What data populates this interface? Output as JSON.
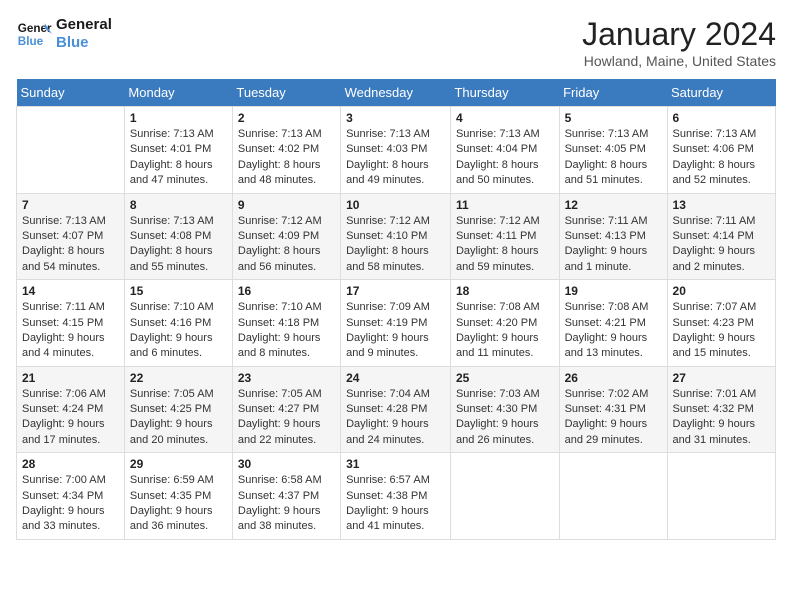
{
  "header": {
    "logo_line1": "General",
    "logo_line2": "Blue",
    "month_title": "January 2024",
    "location": "Howland, Maine, United States"
  },
  "days_of_week": [
    "Sunday",
    "Monday",
    "Tuesday",
    "Wednesday",
    "Thursday",
    "Friday",
    "Saturday"
  ],
  "weeks": [
    [
      {
        "num": "",
        "sunrise": "",
        "sunset": "",
        "daylight": ""
      },
      {
        "num": "1",
        "sunrise": "7:13 AM",
        "sunset": "4:01 PM",
        "daylight": "8 hours and 47 minutes."
      },
      {
        "num": "2",
        "sunrise": "7:13 AM",
        "sunset": "4:02 PM",
        "daylight": "8 hours and 48 minutes."
      },
      {
        "num": "3",
        "sunrise": "7:13 AM",
        "sunset": "4:03 PM",
        "daylight": "8 hours and 49 minutes."
      },
      {
        "num": "4",
        "sunrise": "7:13 AM",
        "sunset": "4:04 PM",
        "daylight": "8 hours and 50 minutes."
      },
      {
        "num": "5",
        "sunrise": "7:13 AM",
        "sunset": "4:05 PM",
        "daylight": "8 hours and 51 minutes."
      },
      {
        "num": "6",
        "sunrise": "7:13 AM",
        "sunset": "4:06 PM",
        "daylight": "8 hours and 52 minutes."
      }
    ],
    [
      {
        "num": "7",
        "sunrise": "7:13 AM",
        "sunset": "4:07 PM",
        "daylight": "8 hours and 54 minutes."
      },
      {
        "num": "8",
        "sunrise": "7:13 AM",
        "sunset": "4:08 PM",
        "daylight": "8 hours and 55 minutes."
      },
      {
        "num": "9",
        "sunrise": "7:12 AM",
        "sunset": "4:09 PM",
        "daylight": "8 hours and 56 minutes."
      },
      {
        "num": "10",
        "sunrise": "7:12 AM",
        "sunset": "4:10 PM",
        "daylight": "8 hours and 58 minutes."
      },
      {
        "num": "11",
        "sunrise": "7:12 AM",
        "sunset": "4:11 PM",
        "daylight": "8 hours and 59 minutes."
      },
      {
        "num": "12",
        "sunrise": "7:11 AM",
        "sunset": "4:13 PM",
        "daylight": "9 hours and 1 minute."
      },
      {
        "num": "13",
        "sunrise": "7:11 AM",
        "sunset": "4:14 PM",
        "daylight": "9 hours and 2 minutes."
      }
    ],
    [
      {
        "num": "14",
        "sunrise": "7:11 AM",
        "sunset": "4:15 PM",
        "daylight": "9 hours and 4 minutes."
      },
      {
        "num": "15",
        "sunrise": "7:10 AM",
        "sunset": "4:16 PM",
        "daylight": "9 hours and 6 minutes."
      },
      {
        "num": "16",
        "sunrise": "7:10 AM",
        "sunset": "4:18 PM",
        "daylight": "9 hours and 8 minutes."
      },
      {
        "num": "17",
        "sunrise": "7:09 AM",
        "sunset": "4:19 PM",
        "daylight": "9 hours and 9 minutes."
      },
      {
        "num": "18",
        "sunrise": "7:08 AM",
        "sunset": "4:20 PM",
        "daylight": "9 hours and 11 minutes."
      },
      {
        "num": "19",
        "sunrise": "7:08 AM",
        "sunset": "4:21 PM",
        "daylight": "9 hours and 13 minutes."
      },
      {
        "num": "20",
        "sunrise": "7:07 AM",
        "sunset": "4:23 PM",
        "daylight": "9 hours and 15 minutes."
      }
    ],
    [
      {
        "num": "21",
        "sunrise": "7:06 AM",
        "sunset": "4:24 PM",
        "daylight": "9 hours and 17 minutes."
      },
      {
        "num": "22",
        "sunrise": "7:05 AM",
        "sunset": "4:25 PM",
        "daylight": "9 hours and 20 minutes."
      },
      {
        "num": "23",
        "sunrise": "7:05 AM",
        "sunset": "4:27 PM",
        "daylight": "9 hours and 22 minutes."
      },
      {
        "num": "24",
        "sunrise": "7:04 AM",
        "sunset": "4:28 PM",
        "daylight": "9 hours and 24 minutes."
      },
      {
        "num": "25",
        "sunrise": "7:03 AM",
        "sunset": "4:30 PM",
        "daylight": "9 hours and 26 minutes."
      },
      {
        "num": "26",
        "sunrise": "7:02 AM",
        "sunset": "4:31 PM",
        "daylight": "9 hours and 29 minutes."
      },
      {
        "num": "27",
        "sunrise": "7:01 AM",
        "sunset": "4:32 PM",
        "daylight": "9 hours and 31 minutes."
      }
    ],
    [
      {
        "num": "28",
        "sunrise": "7:00 AM",
        "sunset": "4:34 PM",
        "daylight": "9 hours and 33 minutes."
      },
      {
        "num": "29",
        "sunrise": "6:59 AM",
        "sunset": "4:35 PM",
        "daylight": "9 hours and 36 minutes."
      },
      {
        "num": "30",
        "sunrise": "6:58 AM",
        "sunset": "4:37 PM",
        "daylight": "9 hours and 38 minutes."
      },
      {
        "num": "31",
        "sunrise": "6:57 AM",
        "sunset": "4:38 PM",
        "daylight": "9 hours and 41 minutes."
      },
      {
        "num": "",
        "sunrise": "",
        "sunset": "",
        "daylight": ""
      },
      {
        "num": "",
        "sunrise": "",
        "sunset": "",
        "daylight": ""
      },
      {
        "num": "",
        "sunrise": "",
        "sunset": "",
        "daylight": ""
      }
    ]
  ]
}
